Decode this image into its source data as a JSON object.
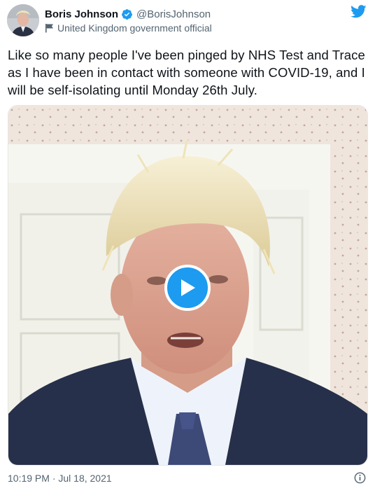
{
  "tweet": {
    "author": {
      "display_name": "Boris Johnson",
      "handle": "@BorisJohnson",
      "verified": true,
      "label": "United Kingdom government official"
    },
    "text": "Like so many people I've been pinged by NHS Test and Trace as I have been in contact with someone with COVID-19, and I will be self-isolating until Monday 26th July.",
    "media": {
      "type": "video",
      "play_icon": "play-icon"
    },
    "timestamp": "10:19 PM · Jul 18, 2021"
  },
  "icons": {
    "brand": "twitter-bird-icon",
    "verified": "verified-badge-icon",
    "label": "flag-icon",
    "info": "info-icon"
  },
  "colors": {
    "accent": "#1d9bf0",
    "text_primary": "#0f1419",
    "text_secondary": "#536471"
  }
}
